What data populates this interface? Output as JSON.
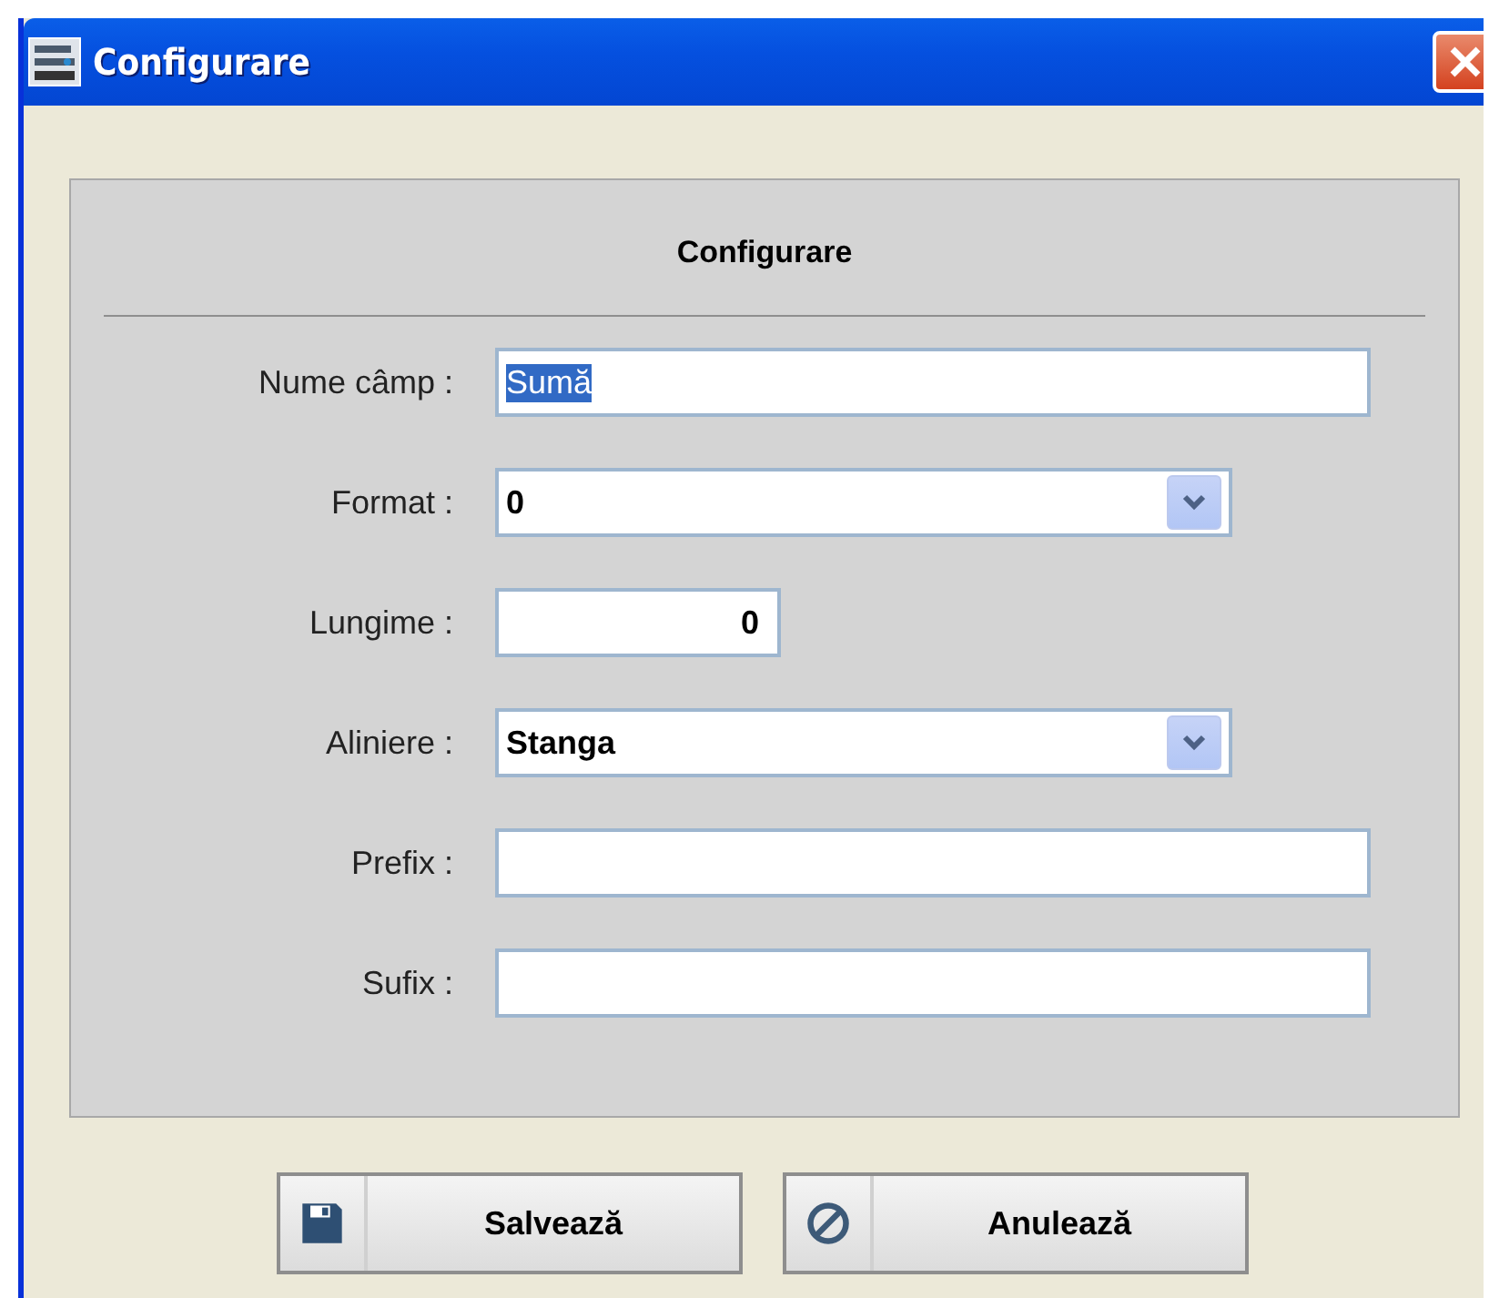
{
  "window": {
    "title": "Configurare"
  },
  "panel": {
    "title": "Configurare"
  },
  "fields": [
    {
      "label": "Nume câmp :",
      "kind": "text",
      "value": "Sumă",
      "text_selected": true
    },
    {
      "label": "Format :",
      "kind": "combo",
      "value": "0"
    },
    {
      "label": "Lungime :",
      "kind": "number",
      "value": "0"
    },
    {
      "label": "Aliniere :",
      "kind": "combo",
      "value": "Stanga"
    },
    {
      "label": "Prefix :",
      "kind": "text"
    },
    {
      "label": "Sufix :",
      "kind": "text"
    }
  ],
  "buttons": [
    {
      "label": "Salvează",
      "kind": "save"
    },
    {
      "label": "Anulează",
      "kind": "cancel"
    }
  ]
}
